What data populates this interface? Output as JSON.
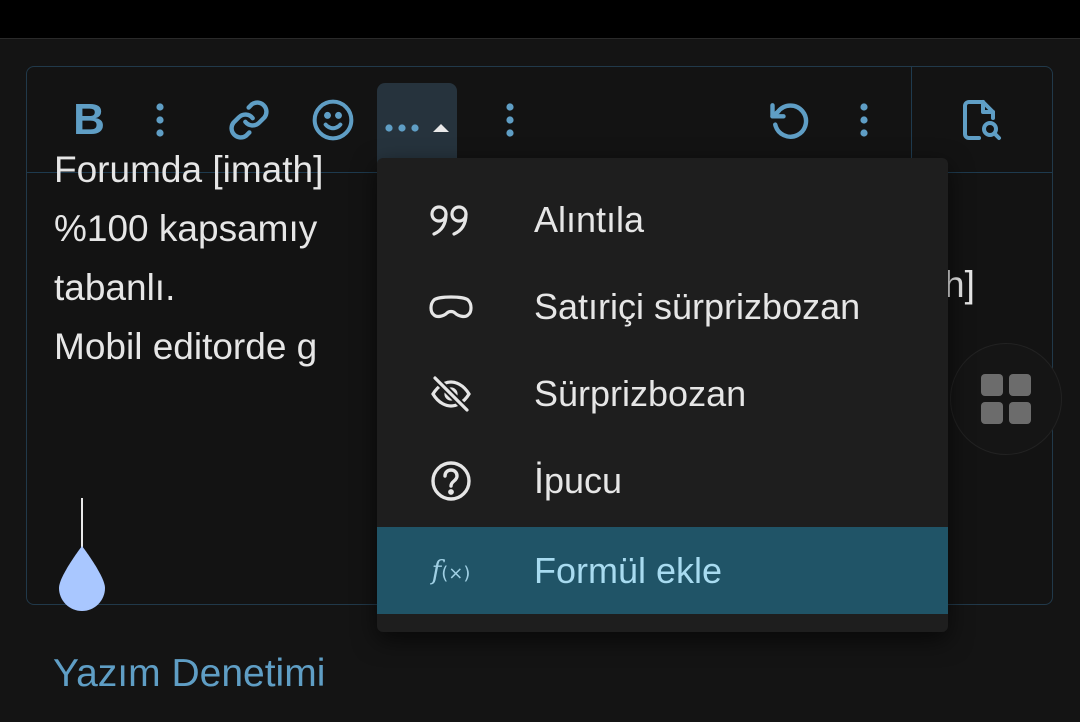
{
  "toolbar": {
    "bold_label": "B",
    "icons": [
      "bold-icon",
      "more-vert-icon",
      "link-icon",
      "emoji-icon",
      "more-horiz-icon",
      "caret-up-icon",
      "more-vert-icon",
      "undo-icon",
      "more-vert-icon",
      "preview-icon"
    ]
  },
  "content": {
    "lines": [
      "Forumda [imath]",
      "%100 kapsamıy",
      "tabanlı.",
      "Mobil editorde g"
    ],
    "right_fragment": "h]"
  },
  "dropdown": {
    "items": [
      {
        "label": "Alıntıla",
        "icon": "quote-icon"
      },
      {
        "label": "Satıriçi sürprizbozan",
        "icon": "inline-spoiler-icon"
      },
      {
        "label": "Sürprizbozan",
        "icon": "eye-off-icon"
      },
      {
        "label": "İpucu",
        "icon": "help-circle-icon"
      },
      {
        "label": "Formül ekle",
        "icon": "formula-icon",
        "icon_text": "f",
        "icon_sub": "(×)",
        "active": true
      }
    ]
  },
  "footer": {
    "spell_check_label": "Yazım Denetimi"
  },
  "colors": {
    "accent": "#5f9ec5",
    "active_item": "#205467",
    "background": "#141414"
  }
}
